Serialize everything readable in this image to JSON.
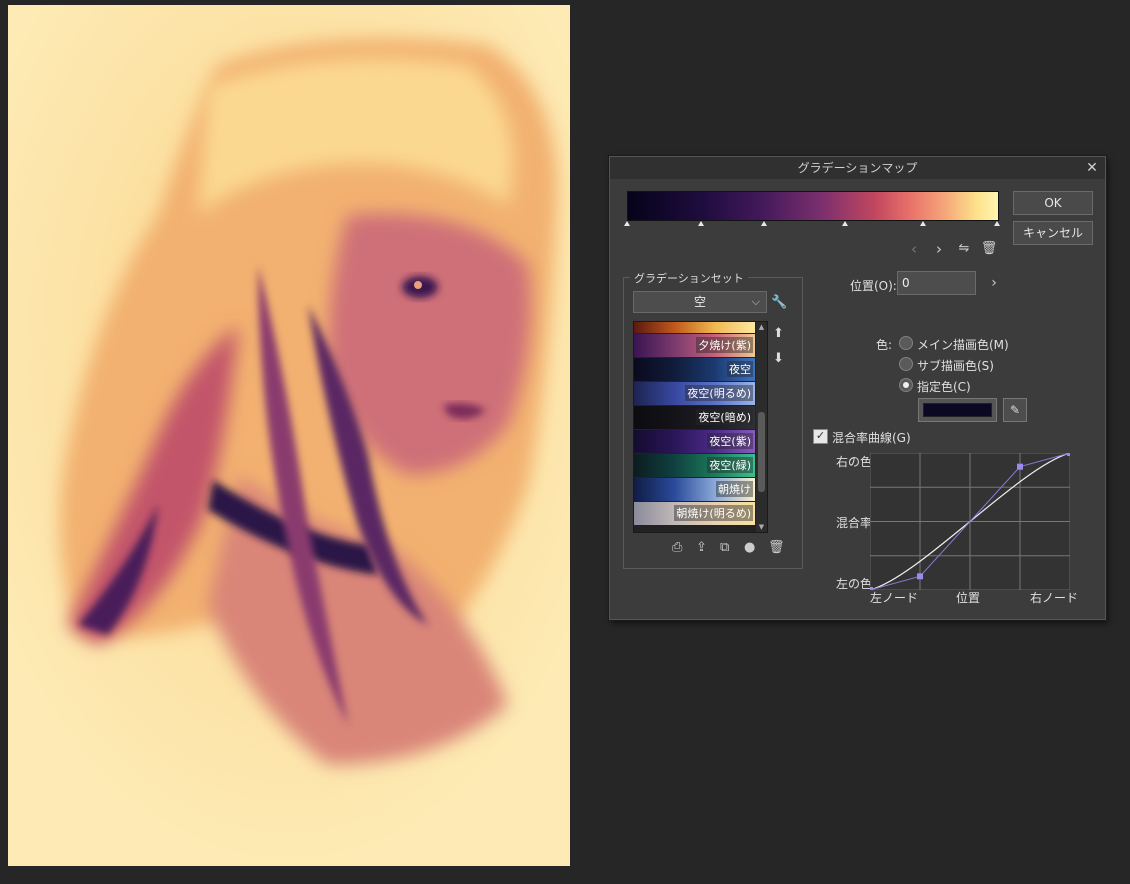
{
  "dialog": {
    "title": "グラデーションマップ",
    "ok_label": "OK",
    "cancel_label": "キャンセル",
    "gradient_set_label": "グラデーションセット",
    "selected_set": "空",
    "presets": [
      {
        "label": "夕焼け(紫)",
        "colors": [
          "#3a1450",
          "#7a3a6e",
          "#c8607a",
          "#f0c890"
        ]
      },
      {
        "label": "夜空",
        "colors": [
          "#0a0a1e",
          "#101c3a",
          "#1c3a70",
          "#3c72c0"
        ]
      },
      {
        "label": "夜空(明るめ)",
        "colors": [
          "#1c2450",
          "#3848a0",
          "#5a72c8",
          "#9ab4ea"
        ]
      },
      {
        "label": "夜空(暗め)",
        "colors": [
          "#0c0c10",
          "#141418",
          "#1c1c24",
          "#303038"
        ]
      },
      {
        "label": "夜空(紫)",
        "colors": [
          "#140c30",
          "#2a1658",
          "#4c2a8a",
          "#8a5ac0"
        ]
      },
      {
        "label": "夜空(緑)",
        "colors": [
          "#0c1c20",
          "#104040",
          "#1a7a5a",
          "#3ac090"
        ]
      },
      {
        "label": "朝焼け",
        "colors": [
          "#101c44",
          "#2a4a9a",
          "#8aa8d8",
          "#f8f0d0"
        ]
      },
      {
        "label": "朝焼け(明るめ)",
        "colors": [
          "#8a8a9a",
          "#c0b8b8",
          "#e8d0b0",
          "#f8e0a0"
        ]
      }
    ],
    "position_label": "位置(O):",
    "position_value": "0",
    "color_label": "色:",
    "color_options": [
      "メイン描画色(M)",
      "サブ描画色(S)",
      "指定色(C)"
    ],
    "color_selected": "指定色(C)",
    "specified_color": "#0a0822",
    "curve_checkbox_label": "混合率曲線(G)",
    "curve_checked": true,
    "curve": {
      "y_labels": {
        "top": "右の色",
        "middle": "混合率",
        "bottom": "左の色"
      },
      "x_labels": {
        "left": "左ノード",
        "middle": "位置",
        "right": "右ノード"
      },
      "control_points": [
        [
          0.0,
          0.0
        ],
        [
          0.25,
          0.1
        ],
        [
          0.75,
          0.9
        ],
        [
          1.0,
          1.0
        ]
      ]
    },
    "gradient_nodes": [
      0.0,
      0.2,
      0.37,
      0.59,
      0.8,
      1.0
    ],
    "gradient_colors": [
      "#06031a",
      "#42195a",
      "#c3475f",
      "#fde18a",
      "#fff4b0"
    ]
  },
  "canvas": {
    "background": "#fdeab4"
  }
}
